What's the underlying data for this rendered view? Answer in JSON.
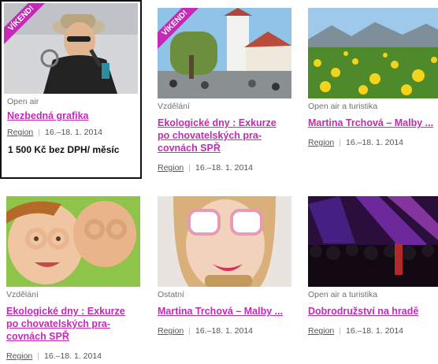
{
  "cards": [
    {
      "ribbon": "VÍKEND!",
      "category": "Open air",
      "title": "Nezbedná grafika",
      "region": "Region",
      "date": "16.–18. 1. 2014",
      "price": "1 500 Kč bez DPH/ měsíc"
    },
    {
      "ribbon": "VÍKEND!",
      "category": "Vzdělání",
      "title_lines": [
        "Ekologické dny : Exkurze",
        "po chovatelských pra-",
        "covnách SPŘ"
      ],
      "region": "Region",
      "date": "16.–18. 1. 2014"
    },
    {
      "category": "Open air a turistika",
      "title": "Martina Trchová – Malby ...",
      "region": "Region",
      "date": "16.–18. 1. 2014"
    },
    {
      "category": "Vzdělání",
      "title_lines": [
        "Ekologické dny : Exkurze",
        "po chovatelských pra-",
        "covnách SPŘ"
      ],
      "region": "Region",
      "date": "16.–18. 1. 2014"
    },
    {
      "category": "Ostatní",
      "title": "Martina Trchová – Malby ...",
      "region": "Region",
      "date": "16.–18. 1. 2014"
    },
    {
      "category": "Open air a turistika",
      "title": "Dobrodružství na hradě",
      "region": "Region",
      "date": "16.–18. 1. 2014"
    }
  ],
  "colors": {
    "accent": "#c42ab6",
    "category": "#707070",
    "meta": "#555555"
  }
}
